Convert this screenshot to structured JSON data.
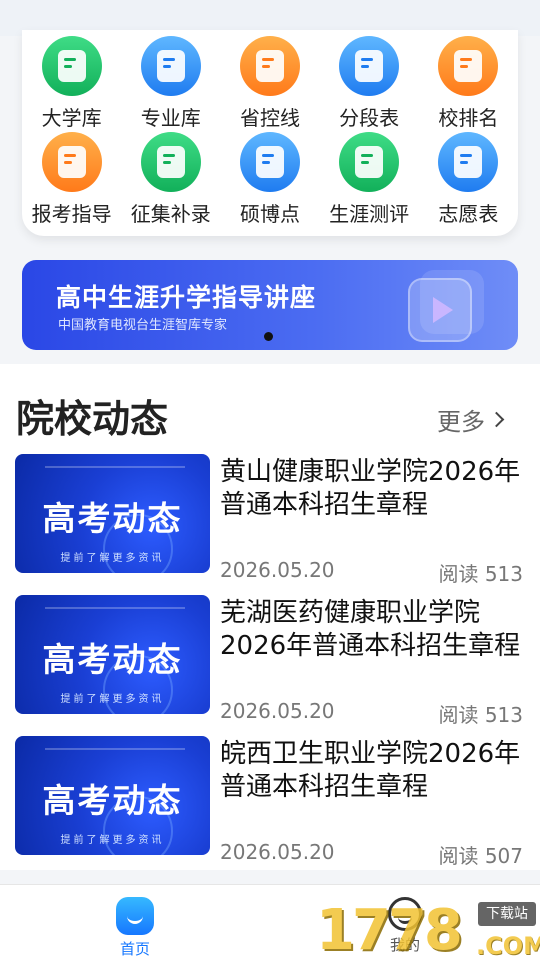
{
  "grid": {
    "row1": [
      {
        "label": "大学库",
        "icon": "school-icon",
        "color": "#1fbf6a"
      },
      {
        "label": "专业库",
        "icon": "book-icon",
        "color": "#2b8cf6"
      },
      {
        "label": "省控线",
        "icon": "chart-line-icon",
        "color": "#ff8a2a"
      },
      {
        "label": "分段表",
        "icon": "table-icon",
        "color": "#2b8cf6"
      },
      {
        "label": "校排名",
        "icon": "crown-icon",
        "color": "#ff8a2a"
      }
    ],
    "row2": [
      {
        "label": "报考指导",
        "icon": "guide-icon",
        "color": "#ff8a2a"
      },
      {
        "label": "征集补录",
        "icon": "collect-icon",
        "color": "#1fbf6a"
      },
      {
        "label": "硕博点",
        "icon": "play-icon",
        "color": "#2b8cf6"
      },
      {
        "label": "生涯测评",
        "icon": "heart-pulse-icon",
        "color": "#1fbf6a"
      },
      {
        "label": "志愿表",
        "icon": "document-icon",
        "color": "#2b8cf6"
      }
    ]
  },
  "banner": {
    "title": "高中生涯升学指导讲座",
    "subtitle": "中国教育电视台生涯智库专家"
  },
  "news": {
    "section_title": "院校动态",
    "more_label": "更多",
    "thumb_heading": "高考动态",
    "thumb_sub": "提前了解更多资讯",
    "items": [
      {
        "title": "黄山健康职业学院2026年普通本科招生章程",
        "date": "2026.05.20",
        "reads": "阅读 513"
      },
      {
        "title": "芜湖医药健康职业学院2026年普通本科招生章程",
        "date": "2026.05.20",
        "reads": "阅读 513"
      },
      {
        "title": "皖西卫生职业学院2026年普通本科招生章程",
        "date": "2026.05.20",
        "reads": "阅读 507"
      }
    ]
  },
  "tabbar": {
    "home_label": "首页",
    "me_label": "我的"
  },
  "watermark": {
    "number": "1778",
    "tag": "下载站",
    "suffix": ".COM"
  }
}
